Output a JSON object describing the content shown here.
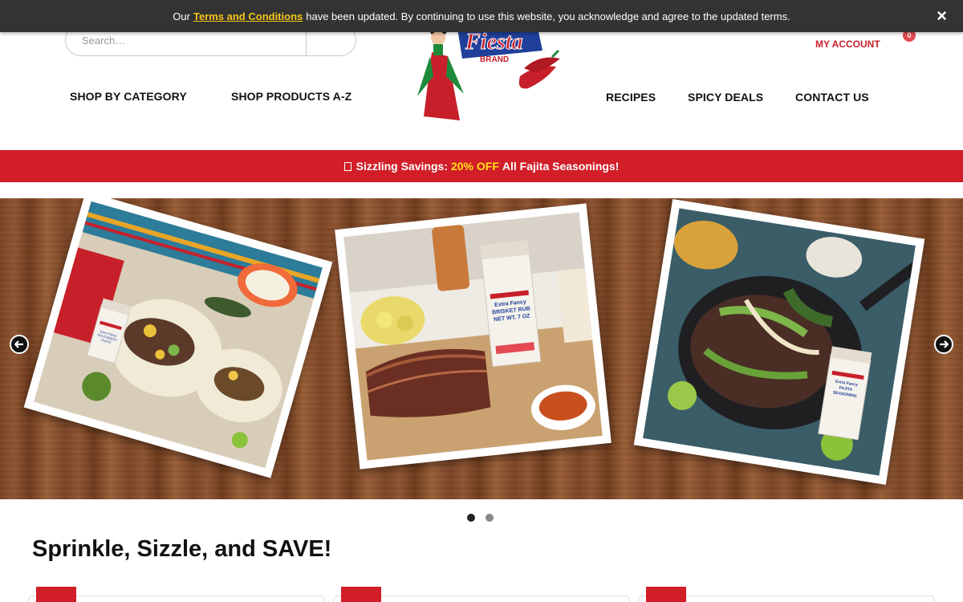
{
  "notice": {
    "prefix": "Our",
    "link": "Terms and Conditions",
    "suffix": "have been updated. By continuing to use this website, you acknowledge and agree to the updated terms.",
    "close_icon": "×"
  },
  "header": {
    "search_placeholder": "Search…",
    "nav_left": [
      "SHOP BY CATEGORY",
      "SHOP PRODUCTS A-Z"
    ],
    "nav_right": [
      "RECIPES",
      "SPICY DEALS",
      "CONTACT US"
    ],
    "logo_text": "Fiesta",
    "logo_sub": "BRAND",
    "account": "MY ACCOUNT",
    "cart_count": "0"
  },
  "promo": {
    "lead": "Sizzling Savings:",
    "highlight": "20% OFF",
    "tail": "All Fajita Seasonings!"
  },
  "hero": {
    "products": [
      {
        "label_line1": "Extra Fancy",
        "label_line2": "SOUTHWEST",
        "label_line3": "FAJITA"
      },
      {
        "label_line1": "Extra Fancy",
        "label_line2": "BRISKET RUB",
        "label_line3": "NET WT. 7 OZ"
      },
      {
        "label_line1": "Extra Fancy",
        "label_line2": "FAJITA",
        "label_line3": "SEASONING"
      }
    ],
    "prev_icon": "arrow-left-icon",
    "next_icon": "arrow-right-icon",
    "slides_count": 2,
    "active_slide": 1
  },
  "section": {
    "title": "Sprinkle, Sizzle, and SAVE!"
  },
  "colors": {
    "brand_red": "#d11e28",
    "notice_bg": "#333333",
    "highlight": "#ffe11a",
    "link_yellow": "#f5c518"
  }
}
